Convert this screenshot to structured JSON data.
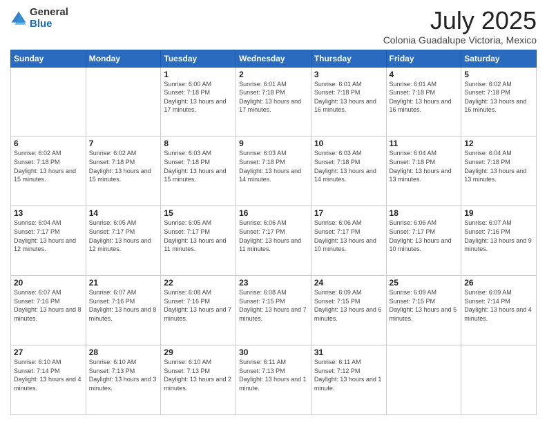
{
  "logo": {
    "general": "General",
    "blue": "Blue"
  },
  "header": {
    "month": "July 2025",
    "location": "Colonia Guadalupe Victoria, Mexico"
  },
  "days_of_week": [
    "Sunday",
    "Monday",
    "Tuesday",
    "Wednesday",
    "Thursday",
    "Friday",
    "Saturday"
  ],
  "weeks": [
    [
      {
        "day": "",
        "info": ""
      },
      {
        "day": "",
        "info": ""
      },
      {
        "day": "1",
        "info": "Sunrise: 6:00 AM\nSunset: 7:18 PM\nDaylight: 13 hours and 17 minutes."
      },
      {
        "day": "2",
        "info": "Sunrise: 6:01 AM\nSunset: 7:18 PM\nDaylight: 13 hours and 17 minutes."
      },
      {
        "day": "3",
        "info": "Sunrise: 6:01 AM\nSunset: 7:18 PM\nDaylight: 13 hours and 16 minutes."
      },
      {
        "day": "4",
        "info": "Sunrise: 6:01 AM\nSunset: 7:18 PM\nDaylight: 13 hours and 16 minutes."
      },
      {
        "day": "5",
        "info": "Sunrise: 6:02 AM\nSunset: 7:18 PM\nDaylight: 13 hours and 16 minutes."
      }
    ],
    [
      {
        "day": "6",
        "info": "Sunrise: 6:02 AM\nSunset: 7:18 PM\nDaylight: 13 hours and 15 minutes."
      },
      {
        "day": "7",
        "info": "Sunrise: 6:02 AM\nSunset: 7:18 PM\nDaylight: 13 hours and 15 minutes."
      },
      {
        "day": "8",
        "info": "Sunrise: 6:03 AM\nSunset: 7:18 PM\nDaylight: 13 hours and 15 minutes."
      },
      {
        "day": "9",
        "info": "Sunrise: 6:03 AM\nSunset: 7:18 PM\nDaylight: 13 hours and 14 minutes."
      },
      {
        "day": "10",
        "info": "Sunrise: 6:03 AM\nSunset: 7:18 PM\nDaylight: 13 hours and 14 minutes."
      },
      {
        "day": "11",
        "info": "Sunrise: 6:04 AM\nSunset: 7:18 PM\nDaylight: 13 hours and 13 minutes."
      },
      {
        "day": "12",
        "info": "Sunrise: 6:04 AM\nSunset: 7:18 PM\nDaylight: 13 hours and 13 minutes."
      }
    ],
    [
      {
        "day": "13",
        "info": "Sunrise: 6:04 AM\nSunset: 7:17 PM\nDaylight: 13 hours and 12 minutes."
      },
      {
        "day": "14",
        "info": "Sunrise: 6:05 AM\nSunset: 7:17 PM\nDaylight: 13 hours and 12 minutes."
      },
      {
        "day": "15",
        "info": "Sunrise: 6:05 AM\nSunset: 7:17 PM\nDaylight: 13 hours and 11 minutes."
      },
      {
        "day": "16",
        "info": "Sunrise: 6:06 AM\nSunset: 7:17 PM\nDaylight: 13 hours and 11 minutes."
      },
      {
        "day": "17",
        "info": "Sunrise: 6:06 AM\nSunset: 7:17 PM\nDaylight: 13 hours and 10 minutes."
      },
      {
        "day": "18",
        "info": "Sunrise: 6:06 AM\nSunset: 7:17 PM\nDaylight: 13 hours and 10 minutes."
      },
      {
        "day": "19",
        "info": "Sunrise: 6:07 AM\nSunset: 7:16 PM\nDaylight: 13 hours and 9 minutes."
      }
    ],
    [
      {
        "day": "20",
        "info": "Sunrise: 6:07 AM\nSunset: 7:16 PM\nDaylight: 13 hours and 8 minutes."
      },
      {
        "day": "21",
        "info": "Sunrise: 6:07 AM\nSunset: 7:16 PM\nDaylight: 13 hours and 8 minutes."
      },
      {
        "day": "22",
        "info": "Sunrise: 6:08 AM\nSunset: 7:16 PM\nDaylight: 13 hours and 7 minutes."
      },
      {
        "day": "23",
        "info": "Sunrise: 6:08 AM\nSunset: 7:15 PM\nDaylight: 13 hours and 7 minutes."
      },
      {
        "day": "24",
        "info": "Sunrise: 6:09 AM\nSunset: 7:15 PM\nDaylight: 13 hours and 6 minutes."
      },
      {
        "day": "25",
        "info": "Sunrise: 6:09 AM\nSunset: 7:15 PM\nDaylight: 13 hours and 5 minutes."
      },
      {
        "day": "26",
        "info": "Sunrise: 6:09 AM\nSunset: 7:14 PM\nDaylight: 13 hours and 4 minutes."
      }
    ],
    [
      {
        "day": "27",
        "info": "Sunrise: 6:10 AM\nSunset: 7:14 PM\nDaylight: 13 hours and 4 minutes."
      },
      {
        "day": "28",
        "info": "Sunrise: 6:10 AM\nSunset: 7:13 PM\nDaylight: 13 hours and 3 minutes."
      },
      {
        "day": "29",
        "info": "Sunrise: 6:10 AM\nSunset: 7:13 PM\nDaylight: 13 hours and 2 minutes."
      },
      {
        "day": "30",
        "info": "Sunrise: 6:11 AM\nSunset: 7:13 PM\nDaylight: 13 hours and 1 minute."
      },
      {
        "day": "31",
        "info": "Sunrise: 6:11 AM\nSunset: 7:12 PM\nDaylight: 13 hours and 1 minute."
      },
      {
        "day": "",
        "info": ""
      },
      {
        "day": "",
        "info": ""
      }
    ]
  ]
}
